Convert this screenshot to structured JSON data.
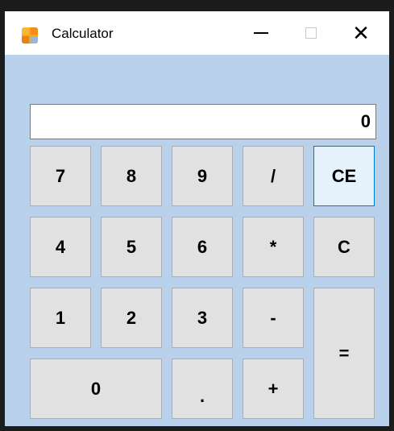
{
  "window": {
    "title": "Calculator",
    "controls": {
      "minimize": "–",
      "maximize": "□",
      "close": "✕"
    }
  },
  "display": {
    "value": "0"
  },
  "keys": {
    "k7": "7",
    "k8": "8",
    "k9": "9",
    "div": "/",
    "ce": "CE",
    "k4": "4",
    "k5": "5",
    "k6": "6",
    "mul": "*",
    "c": "C",
    "k1": "1",
    "k2": "2",
    "k3": "3",
    "sub": "-",
    "eq": "=",
    "k0": "0",
    "dot": ".",
    "add": "+"
  },
  "colors": {
    "client_bg": "#b9d1ea",
    "button_bg": "#e1e1e1",
    "focused_button_bg": "#e5f1fb",
    "focus_border": "#0078d7"
  },
  "icons": {
    "app": "calculator-app-icon"
  }
}
